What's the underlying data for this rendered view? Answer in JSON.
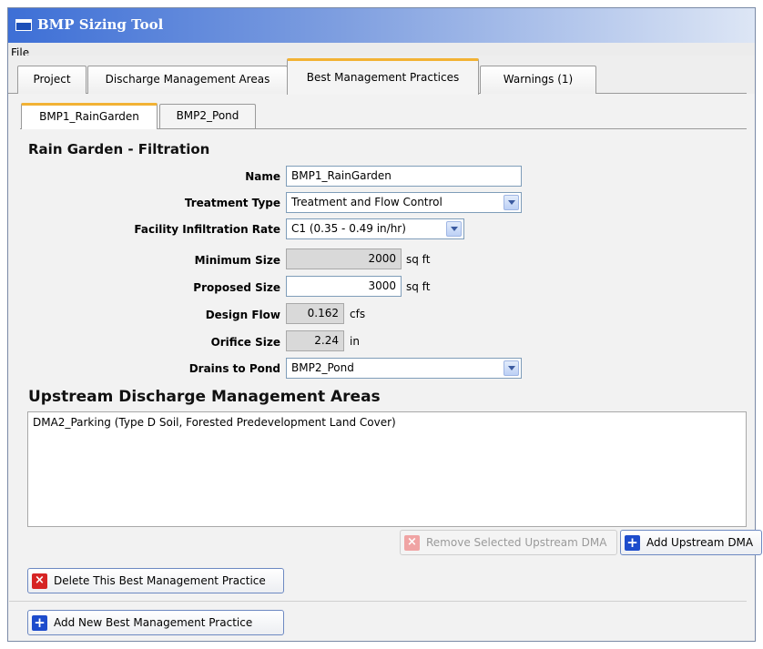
{
  "window": {
    "title": "BMP Sizing Tool"
  },
  "menu": {
    "file": "File"
  },
  "tabs": [
    {
      "label": "Project"
    },
    {
      "label": "Discharge Management Areas"
    },
    {
      "label": "Best Management Practices"
    },
    {
      "label": "Warnings (1)"
    }
  ],
  "subtabs": [
    {
      "label": "BMP1_RainGarden"
    },
    {
      "label": "BMP2_Pond"
    }
  ],
  "form": {
    "section_title": "Rain Garden - Filtration",
    "name_label": "Name",
    "name_value": "BMP1_RainGarden",
    "treatment_label": "Treatment Type",
    "treatment_value": "Treatment and Flow Control",
    "infiltration_label": "Facility Infiltration Rate",
    "infiltration_value": "C1 (0.35 - 0.49 in/hr)",
    "min_size_label": "Minimum Size",
    "min_size_value": "2000",
    "min_size_unit": "sq ft",
    "proposed_size_label": "Proposed Size",
    "proposed_size_value": "3000",
    "proposed_size_unit": "sq ft",
    "design_flow_label": "Design Flow",
    "design_flow_value": "0.162",
    "design_flow_unit": "cfs",
    "orifice_label": "Orifice Size",
    "orifice_value": "2.24",
    "orifice_unit": "in",
    "drains_label": "Drains to Pond",
    "drains_value": "BMP2_Pond"
  },
  "upstream": {
    "title": "Upstream Discharge Management Areas",
    "items": [
      "DMA2_Parking (Type D Soil, Forested Predevelopment Land Cover)"
    ],
    "remove_label": "Remove Selected Upstream DMA",
    "add_label": "Add Upstream DMA"
  },
  "actions": {
    "delete_label": "Delete This Best Management Practice",
    "add_new_label": "Add New Best Management Practice"
  },
  "colors": {
    "tab_accent": "#f2b234",
    "titlebar": "#3d6fd6",
    "delete_icon": "#d62424",
    "add_icon": "#1d4ccc"
  }
}
